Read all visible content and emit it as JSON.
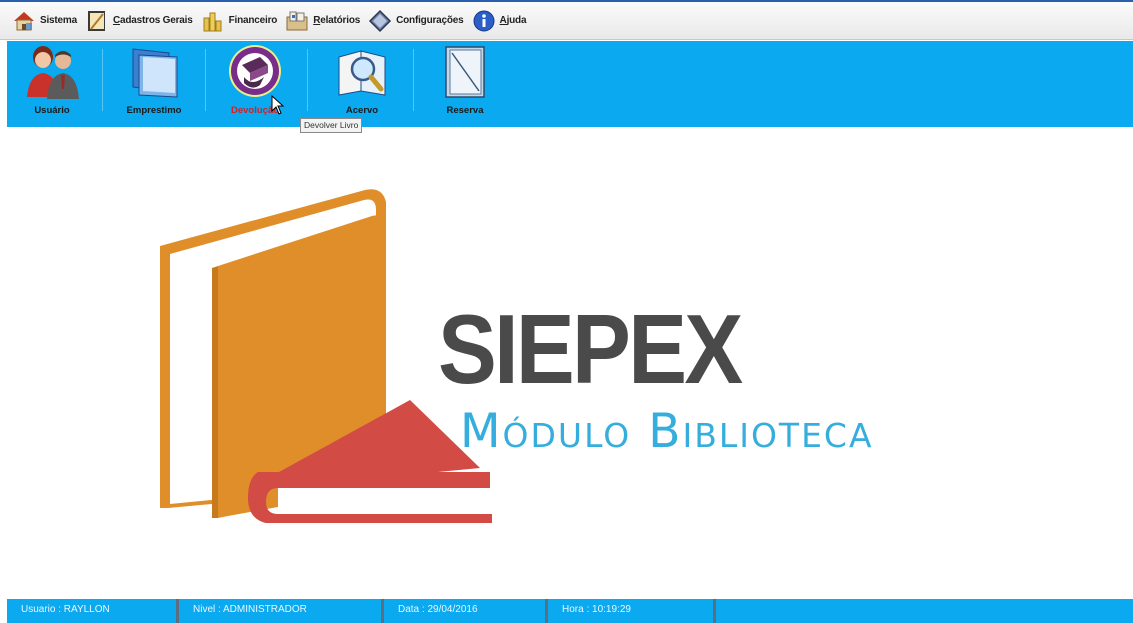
{
  "menu": {
    "items": [
      {
        "label": "Sistema",
        "icon": "house-icon"
      },
      {
        "label": "Cadastros Gerais",
        "icon": "register-book-icon"
      },
      {
        "label": "Financeiro",
        "icon": "coins-icon"
      },
      {
        "label": "Relatórios",
        "icon": "reports-icon"
      },
      {
        "label": "Configurações",
        "icon": "diamond-icon"
      },
      {
        "label": "Ajuda",
        "icon": "info-icon"
      }
    ]
  },
  "toolbar": {
    "items": [
      {
        "label": "Usuário",
        "icon": "users-icon"
      },
      {
        "label": "Emprestimo",
        "icon": "books-icon"
      },
      {
        "label": "Devolução",
        "icon": "return-book-icon",
        "hovered": true
      },
      {
        "label": "Acervo",
        "icon": "magnifier-book-icon"
      },
      {
        "label": "Reserva",
        "icon": "notebook-icon"
      }
    ],
    "tooltip": "Devolver Livro"
  },
  "brand": {
    "title": "SIEPEX",
    "subtitle": "Módulo Biblioteca"
  },
  "status": {
    "user": "Usuario : RAYLLON",
    "level": "Nivel : ADMINISTRADOR",
    "date": "Data : 29/04/2016",
    "time": "Hora : 10:19:29"
  },
  "colors": {
    "toolbar_bg": "#0aa9f0",
    "title_gray": "#4a4a4a",
    "subtitle_blue": "#36aedd",
    "book_orange": "#e08e2a",
    "book_red": "#d24b44",
    "hover_label": "#d62020"
  }
}
